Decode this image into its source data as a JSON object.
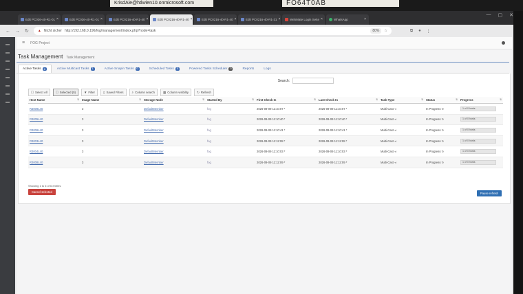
{
  "sticky_notes": [
    {
      "text": "KrisdAle@htlwien10.onmicrosoft.com"
    },
    {
      "text": "FO64T0AB"
    }
  ],
  "browser": {
    "tabs": [
      {
        "label": "Edit PC036-40-R1-01",
        "icon": "page-icon"
      },
      {
        "label": "Edit PC036-40-R1-01",
        "icon": "page-icon"
      },
      {
        "label": "Edit PC0216-40-R1-40",
        "icon": "page-icon"
      },
      {
        "label": "Edit PC0216-40-R1-40",
        "icon": "page-icon",
        "active": true
      },
      {
        "label": "Edit PC0216-40-R1-40",
        "icon": "page-icon"
      },
      {
        "label": "Edit PC0216-40-R1-31",
        "icon": "page-icon"
      },
      {
        "label": "WebMate Login Seite",
        "icon": "webmate-icon"
      },
      {
        "label": "WhatsApp",
        "icon": "whatsapp-icon"
      }
    ],
    "security_label": "Nicht sicher",
    "url": "http://192.168.0.196/fog/management/index.php?node=task",
    "zoom": "80%"
  },
  "app": {
    "brand": "FOG Project",
    "title": "Task Management",
    "subtitle": "Task Management"
  },
  "section_tabs": [
    {
      "label": "Active Tasks",
      "badge": "6",
      "active": true
    },
    {
      "label": "Active Multicast Tasks",
      "badge": "1"
    },
    {
      "label": "Active Snapin Tasks",
      "badge": "0"
    },
    {
      "label": "Scheduled Tasks",
      "badge": "0"
    },
    {
      "label": "Powered Tasks Scheduler",
      "badge": "0"
    },
    {
      "label": "Reports",
      "badge": ""
    },
    {
      "label": "Logs",
      "badge": ""
    }
  ],
  "search": {
    "label": "Search:",
    "value": ""
  },
  "toolbar": [
    {
      "label": "Select All",
      "icon": "checkbox-icon",
      "selected": false
    },
    {
      "label": "Selected (0)",
      "icon": "checkbox-icon",
      "selected": true
    },
    {
      "label": "Filter",
      "icon": "filter-icon",
      "selected": false
    },
    {
      "label": "Saved Filters",
      "icon": "bookmark-icon",
      "selected": false
    },
    {
      "label": "Column search",
      "icon": "search-icon",
      "selected": false
    },
    {
      "label": "Column visibility",
      "icon": "table-icon",
      "selected": false
    },
    {
      "label": "Refresh",
      "icon": "refresh-icon",
      "selected": false
    }
  ],
  "table": {
    "columns": [
      "Host Name",
      "Image Name",
      "Storage Node",
      "Started By",
      "First Check In",
      "Last Check In",
      "Task Type",
      "Status",
      "Progress"
    ],
    "rows": [
      {
        "host": "R3009L40",
        "image": "3",
        "node": "DefaultMember",
        "by": "fog",
        "first": "2026-09-09 11:10:07 *",
        "last": "2026-09-09 11:10:07 *",
        "type": "Multi-Cast",
        "status": "In Progress",
        "progress": "1 of 0 hosts"
      },
      {
        "host": "R3005L40",
        "image": "3",
        "node": "DefaultMember",
        "by": "fog",
        "first": "2026-09-09 11:10:40 *",
        "last": "2026-09-09 11:10:40 *",
        "type": "Multi-Cast",
        "status": "In Progress",
        "progress": "1 of 0 hosts"
      },
      {
        "host": "R3006L40",
        "image": "3",
        "node": "DefaultMember",
        "by": "fog",
        "first": "2026-09-09 11:10:41 *",
        "last": "2026-09-09 11:10:41 *",
        "type": "Multi-Cast",
        "status": "In Progress",
        "progress": "1 of 0 hosts"
      },
      {
        "host": "R3003L40",
        "image": "3",
        "node": "DefaultMember",
        "by": "fog",
        "first": "2026-09-09 11:12:08 *",
        "last": "2026-09-09 11:12:08 *",
        "type": "Multi-Cast",
        "status": "In Progress",
        "progress": "1 of 0 hosts"
      },
      {
        "host": "R3004L40",
        "image": "3",
        "node": "DefaultMember",
        "by": "fog",
        "first": "2026-09-09 11:10:03 *",
        "last": "2026-09-09 11:10:03 *",
        "type": "Multi-Cast",
        "status": "In Progress",
        "progress": "1 of 0 hosts"
      },
      {
        "host": "R3008L40",
        "image": "3",
        "node": "DefaultMember",
        "by": "fog",
        "first": "2026-09-09 11:12:09 *",
        "last": "2026-09-09 11:12:09 *",
        "type": "Multi-Cast",
        "status": "In Progress",
        "progress": "1 of 0 hosts"
      }
    ]
  },
  "footer": {
    "info": "Showing 1 to 6 of 6 entries",
    "cancel_label": "Cancel selected",
    "pause_label": "Pause refresh"
  },
  "colors": {
    "accent": "#3f6cb4",
    "danger": "#c9433d",
    "link": "#4a70b0"
  }
}
